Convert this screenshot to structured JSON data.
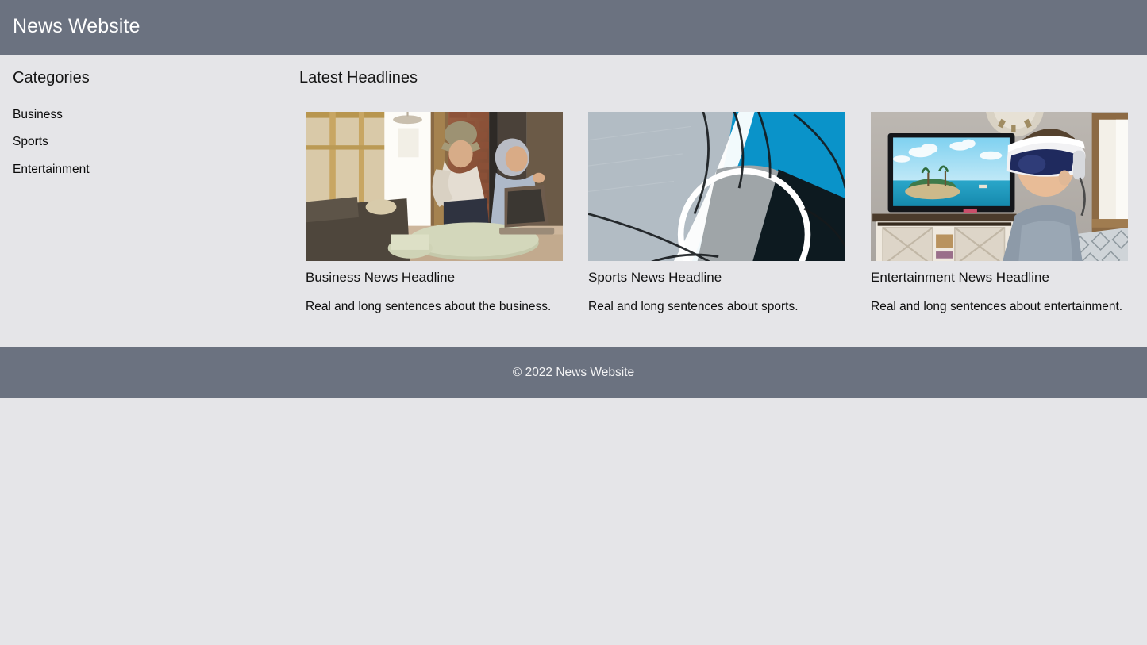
{
  "header": {
    "title": "News Website",
    "background_color": "#6b7280",
    "text_color": "#ffffff"
  },
  "sidebar": {
    "title": "Categories",
    "items": [
      {
        "label": "Business"
      },
      {
        "label": "Sports"
      },
      {
        "label": "Entertainment"
      }
    ]
  },
  "main": {
    "title": "Latest Headlines",
    "cards": [
      {
        "image_alt": "two-women-at-outdoor-cafe-with-laptop",
        "headline": "Business News Headline",
        "text": "Real and long sentences about the business."
      },
      {
        "image_alt": "aerial-view-of-blue-and-grey-sports-court",
        "headline": "Sports News Headline",
        "text": "Real and long sentences about sports."
      },
      {
        "image_alt": "boy-wearing-vr-headset-in-front-of-television",
        "headline": "Entertainment News Headline",
        "text": "Real and long sentences about entertainment."
      }
    ]
  },
  "footer": {
    "copyright": "© 2022 News Website",
    "background_color": "#6b7280",
    "text_color": "#f3f3f4"
  },
  "page": {
    "background_color": "#e5e5e8"
  }
}
